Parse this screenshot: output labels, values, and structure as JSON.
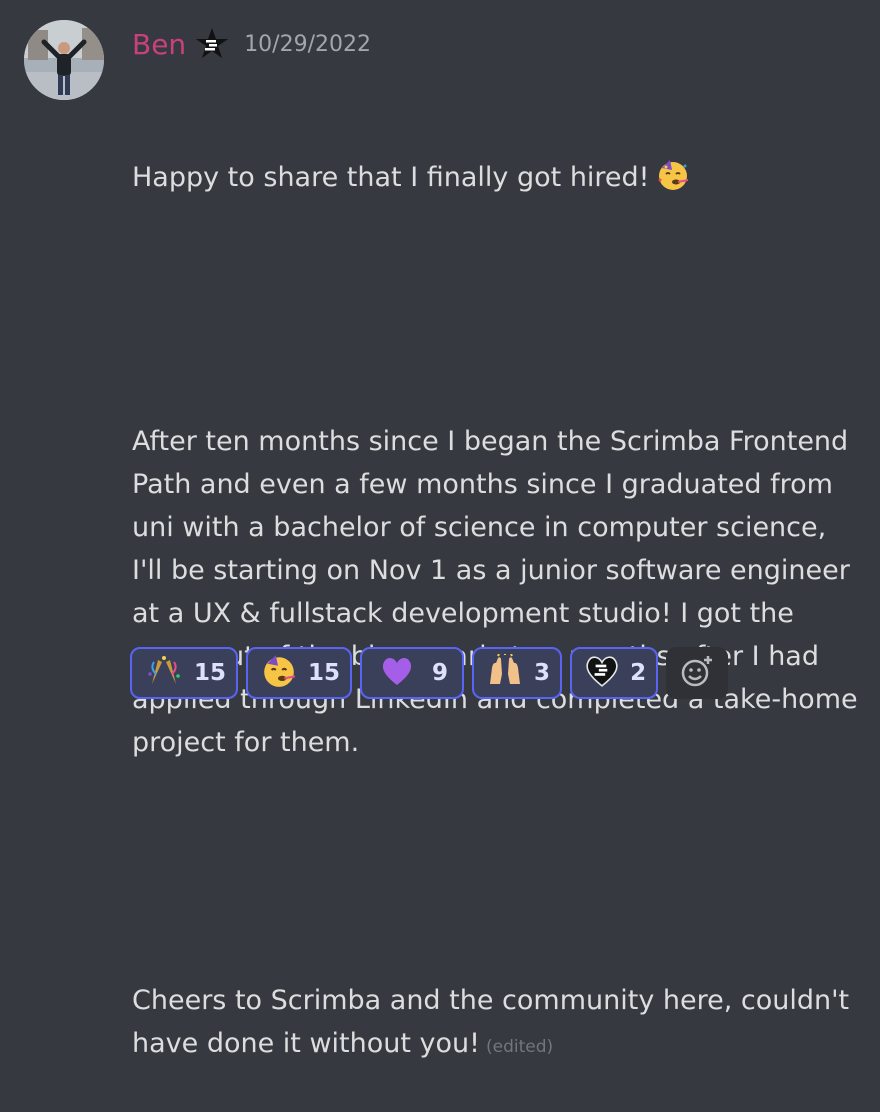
{
  "message": {
    "author": "Ben",
    "timestamp": "10/29/2022",
    "line1": "Happy to share that I finally got hired!",
    "paragraph2": "After ten months since I began the Scrimba Frontend Path and even a few months since I graduated from uni with a bachelor of science in computer science, I'll be starting on Nov 1 as a junior software engineer at a UX & fullstack development studio! I got the news out of the blue nearly two months after I had applied through LinkedIn and completed a take-home project for them.",
    "paragraph3": "Cheers to Scrimba and the community here, couldn't have done it without you!",
    "edited_label": "(edited)"
  },
  "reactions": [
    {
      "icon": "confetti-icon",
      "count": "15"
    },
    {
      "icon": "partying-face-icon",
      "count": "15"
    },
    {
      "icon": "purple-heart-icon",
      "count": "9"
    },
    {
      "icon": "raising-hands-icon",
      "count": "3"
    },
    {
      "icon": "scrimba-heart-icon",
      "count": "2"
    }
  ],
  "colors": {
    "background": "#36393f",
    "username": "#c9417a",
    "reaction_border": "#5865f2",
    "reaction_bg": "#3b405a"
  }
}
